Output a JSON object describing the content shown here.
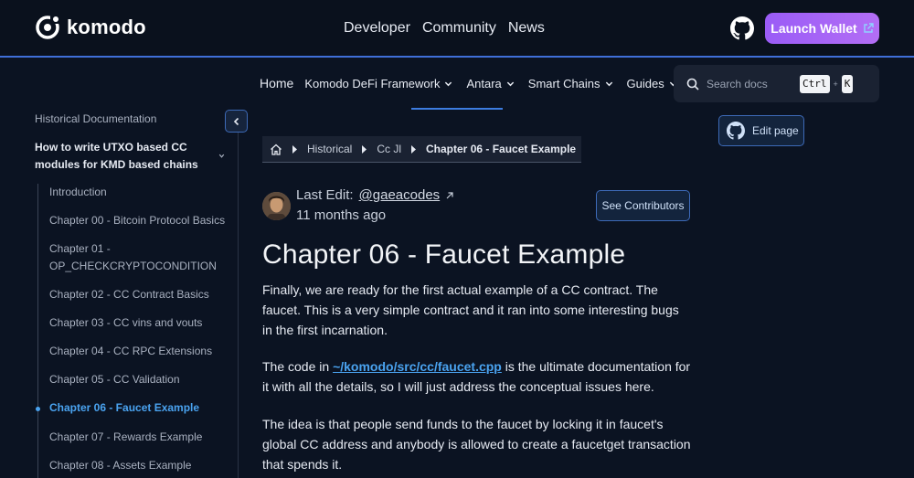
{
  "header": {
    "brand": "komodo",
    "nav": [
      "Developer",
      "Community",
      "News"
    ],
    "launch_label": "Launch Wallet"
  },
  "subnav": {
    "home": "Home",
    "items": [
      "Komodo DeFi Framework",
      "Antara",
      "Smart Chains",
      "Guides"
    ]
  },
  "search": {
    "placeholder": "Search docs",
    "key1": "Ctrl",
    "plus": "+",
    "key2": "K"
  },
  "sidebar": {
    "heading": "Historical Documentation",
    "section": "How to write UTXO based CC modules for KMD based chains",
    "items": [
      "Introduction",
      "Chapter 00 - Bitcoin Protocol Basics",
      "Chapter 01 - OP_CHECKCRYPTOCONDITION",
      "Chapter 02 - CC Contract Basics",
      "Chapter 03 - CC vins and vouts",
      "Chapter 04 - CC RPC Extensions",
      "Chapter 05 - CC Validation",
      "Chapter 06 - Faucet Example",
      "Chapter 07 - Rewards Example",
      "Chapter 08 - Assets Example"
    ],
    "active_index": 7
  },
  "breadcrumb": [
    "Historical",
    "Cc Jl",
    "Chapter 06 - Faucet Example"
  ],
  "meta": {
    "last_edit_label": "Last Edit:",
    "user": "@gaeacodes",
    "ago": "11 months ago",
    "contributors_label": "See Contributors",
    "edit_page_label": "Edit page"
  },
  "article": {
    "title": "Chapter 06 - Faucet Example",
    "p1": "Finally, we are ready for the first actual example of a CC contract. The faucet. This is a very simple contract and it ran into some interesting bugs in the first incarnation.",
    "p2_before": "The code in ",
    "p2_link": "~/komodo/src/cc/faucet.cpp",
    "p2_after": " is the ultimate documentation for it with all the details, so I will just address the conceptual issues here.",
    "p3": "The idea is that people send funds to the faucet by locking it in faucet's global CC address and anybody is allowed to create a faucetget transaction that spends it."
  },
  "colors": {
    "background": "#0b1322",
    "accent_link": "#4aa3f0",
    "launch_gradient_start": "#9a5cf6",
    "nav_border": "#3f6fd8"
  }
}
